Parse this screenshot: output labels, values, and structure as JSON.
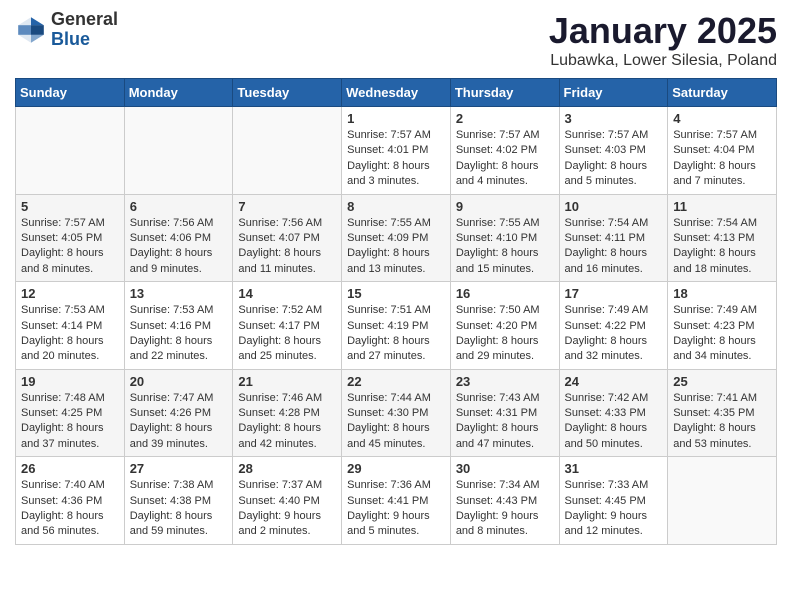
{
  "header": {
    "logo_general": "General",
    "logo_blue": "Blue",
    "month_title": "January 2025",
    "location": "Lubawka, Lower Silesia, Poland"
  },
  "weekdays": [
    "Sunday",
    "Monday",
    "Tuesday",
    "Wednesday",
    "Thursday",
    "Friday",
    "Saturday"
  ],
  "weeks": [
    [
      {
        "day": "",
        "info": ""
      },
      {
        "day": "",
        "info": ""
      },
      {
        "day": "",
        "info": ""
      },
      {
        "day": "1",
        "info": "Sunrise: 7:57 AM\nSunset: 4:01 PM\nDaylight: 8 hours and 3 minutes."
      },
      {
        "day": "2",
        "info": "Sunrise: 7:57 AM\nSunset: 4:02 PM\nDaylight: 8 hours and 4 minutes."
      },
      {
        "day": "3",
        "info": "Sunrise: 7:57 AM\nSunset: 4:03 PM\nDaylight: 8 hours and 5 minutes."
      },
      {
        "day": "4",
        "info": "Sunrise: 7:57 AM\nSunset: 4:04 PM\nDaylight: 8 hours and 7 minutes."
      }
    ],
    [
      {
        "day": "5",
        "info": "Sunrise: 7:57 AM\nSunset: 4:05 PM\nDaylight: 8 hours and 8 minutes."
      },
      {
        "day": "6",
        "info": "Sunrise: 7:56 AM\nSunset: 4:06 PM\nDaylight: 8 hours and 9 minutes."
      },
      {
        "day": "7",
        "info": "Sunrise: 7:56 AM\nSunset: 4:07 PM\nDaylight: 8 hours and 11 minutes."
      },
      {
        "day": "8",
        "info": "Sunrise: 7:55 AM\nSunset: 4:09 PM\nDaylight: 8 hours and 13 minutes."
      },
      {
        "day": "9",
        "info": "Sunrise: 7:55 AM\nSunset: 4:10 PM\nDaylight: 8 hours and 15 minutes."
      },
      {
        "day": "10",
        "info": "Sunrise: 7:54 AM\nSunset: 4:11 PM\nDaylight: 8 hours and 16 minutes."
      },
      {
        "day": "11",
        "info": "Sunrise: 7:54 AM\nSunset: 4:13 PM\nDaylight: 8 hours and 18 minutes."
      }
    ],
    [
      {
        "day": "12",
        "info": "Sunrise: 7:53 AM\nSunset: 4:14 PM\nDaylight: 8 hours and 20 minutes."
      },
      {
        "day": "13",
        "info": "Sunrise: 7:53 AM\nSunset: 4:16 PM\nDaylight: 8 hours and 22 minutes."
      },
      {
        "day": "14",
        "info": "Sunrise: 7:52 AM\nSunset: 4:17 PM\nDaylight: 8 hours and 25 minutes."
      },
      {
        "day": "15",
        "info": "Sunrise: 7:51 AM\nSunset: 4:19 PM\nDaylight: 8 hours and 27 minutes."
      },
      {
        "day": "16",
        "info": "Sunrise: 7:50 AM\nSunset: 4:20 PM\nDaylight: 8 hours and 29 minutes."
      },
      {
        "day": "17",
        "info": "Sunrise: 7:49 AM\nSunset: 4:22 PM\nDaylight: 8 hours and 32 minutes."
      },
      {
        "day": "18",
        "info": "Sunrise: 7:49 AM\nSunset: 4:23 PM\nDaylight: 8 hours and 34 minutes."
      }
    ],
    [
      {
        "day": "19",
        "info": "Sunrise: 7:48 AM\nSunset: 4:25 PM\nDaylight: 8 hours and 37 minutes."
      },
      {
        "day": "20",
        "info": "Sunrise: 7:47 AM\nSunset: 4:26 PM\nDaylight: 8 hours and 39 minutes."
      },
      {
        "day": "21",
        "info": "Sunrise: 7:46 AM\nSunset: 4:28 PM\nDaylight: 8 hours and 42 minutes."
      },
      {
        "day": "22",
        "info": "Sunrise: 7:44 AM\nSunset: 4:30 PM\nDaylight: 8 hours and 45 minutes."
      },
      {
        "day": "23",
        "info": "Sunrise: 7:43 AM\nSunset: 4:31 PM\nDaylight: 8 hours and 47 minutes."
      },
      {
        "day": "24",
        "info": "Sunrise: 7:42 AM\nSunset: 4:33 PM\nDaylight: 8 hours and 50 minutes."
      },
      {
        "day": "25",
        "info": "Sunrise: 7:41 AM\nSunset: 4:35 PM\nDaylight: 8 hours and 53 minutes."
      }
    ],
    [
      {
        "day": "26",
        "info": "Sunrise: 7:40 AM\nSunset: 4:36 PM\nDaylight: 8 hours and 56 minutes."
      },
      {
        "day": "27",
        "info": "Sunrise: 7:38 AM\nSunset: 4:38 PM\nDaylight: 8 hours and 59 minutes."
      },
      {
        "day": "28",
        "info": "Sunrise: 7:37 AM\nSunset: 4:40 PM\nDaylight: 9 hours and 2 minutes."
      },
      {
        "day": "29",
        "info": "Sunrise: 7:36 AM\nSunset: 4:41 PM\nDaylight: 9 hours and 5 minutes."
      },
      {
        "day": "30",
        "info": "Sunrise: 7:34 AM\nSunset: 4:43 PM\nDaylight: 9 hours and 8 minutes."
      },
      {
        "day": "31",
        "info": "Sunrise: 7:33 AM\nSunset: 4:45 PM\nDaylight: 9 hours and 12 minutes."
      },
      {
        "day": "",
        "info": ""
      }
    ]
  ]
}
